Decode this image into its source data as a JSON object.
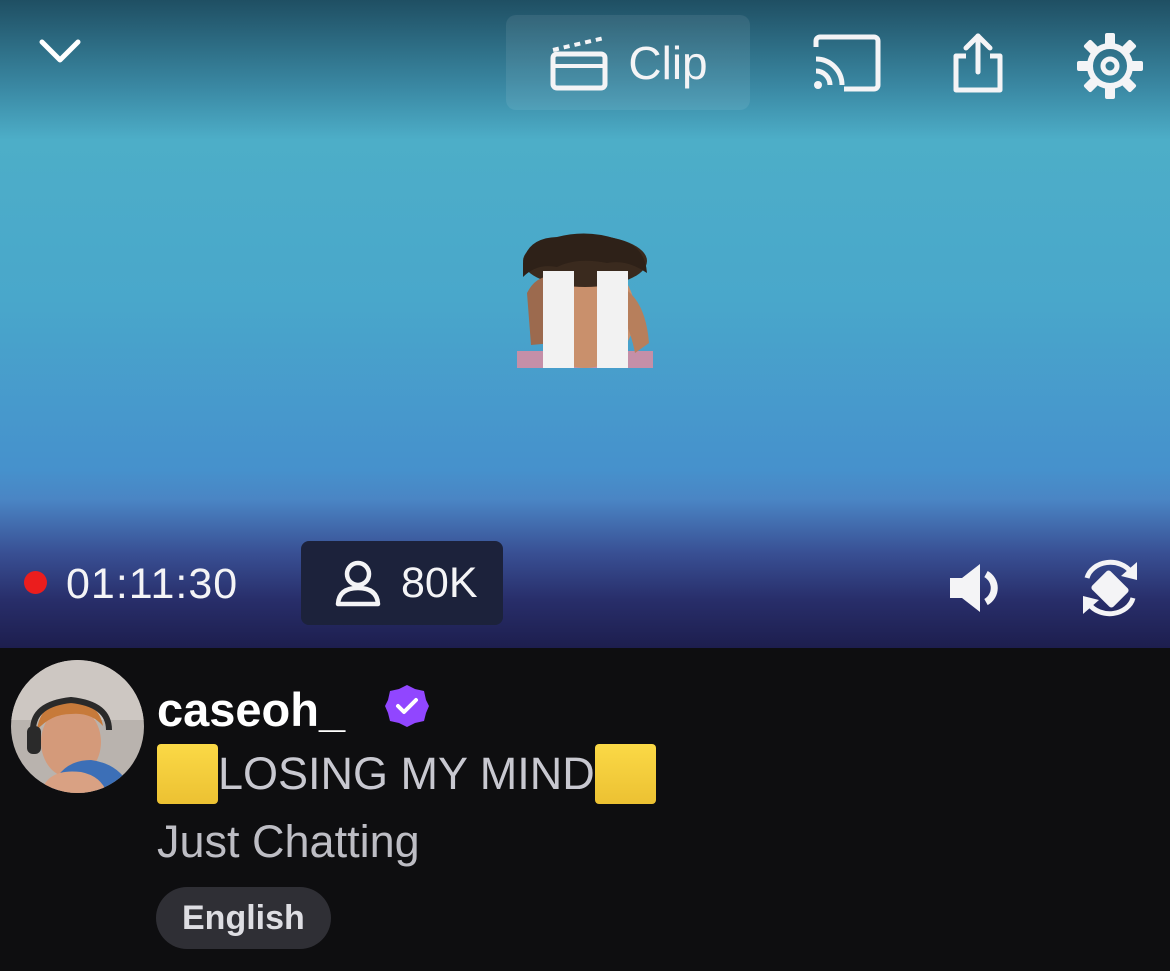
{
  "player": {
    "clip_label": "Clip",
    "uptime": "01:11:30",
    "viewer_count": "80K",
    "live_color": "#eb1d1d"
  },
  "icons": {
    "top_left": "chevron-down-icon",
    "clip": "clapperboard-icon",
    "cast": "cast-icon",
    "share": "share-icon",
    "settings": "gear-icon",
    "viewers": "person-icon",
    "volume": "speaker-icon",
    "rotate": "rotate-screen-icon",
    "center": "pause-icon"
  },
  "stream": {
    "channel_name": "caseoh_",
    "title": "LOSING MY MIND",
    "title_emoji": "yellow-square",
    "category": "Just Chatting",
    "tags": [
      "English"
    ],
    "verified_color": "#9146ff"
  }
}
